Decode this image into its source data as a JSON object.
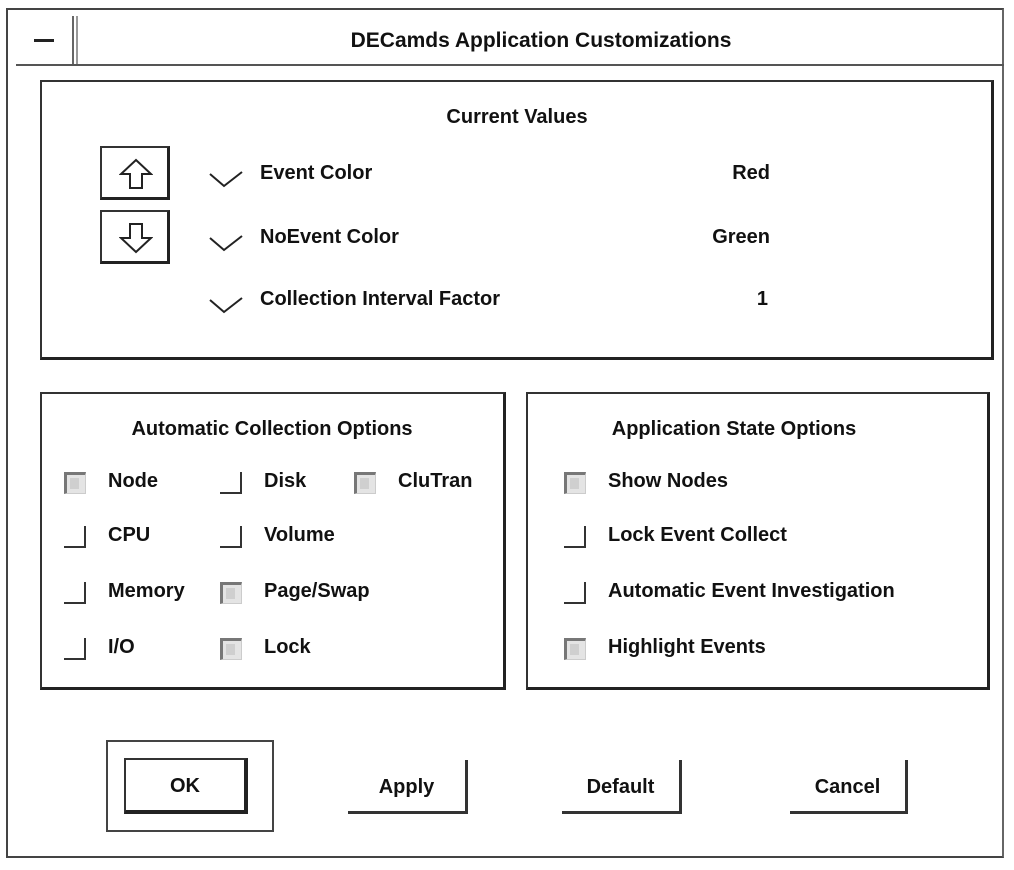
{
  "window": {
    "title": "DECamds Application Customizations"
  },
  "current_values": {
    "title": "Current Values",
    "rows": [
      {
        "name": "Event Color",
        "value": "Red"
      },
      {
        "name": "NoEvent Color",
        "value": "Green"
      },
      {
        "name": "Collection Interval Factor",
        "value": "1"
      }
    ],
    "up_icon": "arrow-up-icon",
    "down_icon": "arrow-down-icon"
  },
  "collection_options": {
    "title": "Automatic Collection Options",
    "items": [
      {
        "label": "Node",
        "checked": true
      },
      {
        "label": "Disk",
        "checked": false
      },
      {
        "label": "CluTran",
        "checked": true
      },
      {
        "label": "CPU",
        "checked": false
      },
      {
        "label": "Volume",
        "checked": false
      },
      {
        "label": "Memory",
        "checked": false
      },
      {
        "label": "Page/Swap",
        "checked": true
      },
      {
        "label": "I/O",
        "checked": false
      },
      {
        "label": "Lock",
        "checked": true
      }
    ]
  },
  "state_options": {
    "title": "Application State Options",
    "items": [
      {
        "label": "Show Nodes",
        "checked": true
      },
      {
        "label": "Lock Event Collect",
        "checked": false
      },
      {
        "label": "Automatic Event Investigation",
        "checked": false
      },
      {
        "label": "Highlight Events",
        "checked": true
      }
    ]
  },
  "buttons": {
    "ok": "OK",
    "apply": "Apply",
    "default": "Default",
    "cancel": "Cancel"
  }
}
